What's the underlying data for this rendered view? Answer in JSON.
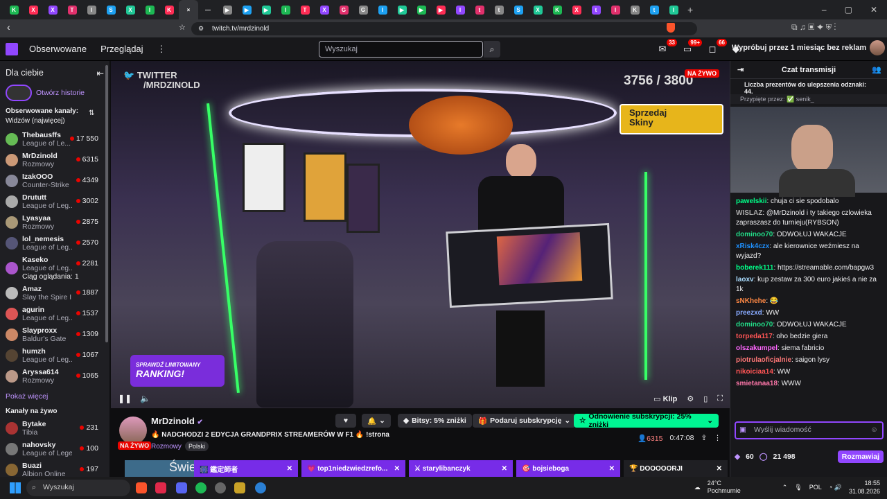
{
  "browser": {
    "url": "twitch.tv/mrdzinold",
    "tabs": [
      "K",
      "X",
      "X",
      "T",
      "I",
      "S",
      "X",
      "I",
      "K",
      "×",
      "—",
      "▶",
      "▶",
      "▶",
      "I",
      "T",
      "X",
      "G",
      "G",
      "I",
      "▶",
      "▶",
      "▶",
      "I",
      "t",
      "t",
      "S",
      "X",
      "K",
      "X",
      "t",
      "I",
      "K",
      "t",
      "I"
    ],
    "new_tab": "+",
    "ctl_min": "–",
    "ctl_max": "▢",
    "ctl_close": "✕"
  },
  "twitch": {
    "following": "Obserwowane",
    "browse": "Przeglądaj",
    "more": "⋮",
    "search_placeholder": "Wyszukaj",
    "badges": [
      "33",
      "99+",
      "66"
    ],
    "turbo": "Wypróbuj przez 1 miesiąc bez reklam"
  },
  "sidebar": {
    "title": "Dla ciebie",
    "stories": "Otwórz historie",
    "followed_label": "Obserwowane kanały:",
    "sort": "Widzów (najwięcej)",
    "channels": [
      {
        "name": "Thebausffs",
        "game": "League of Le...",
        "viewers": "17 550",
        "c": "#6b5"
      },
      {
        "name": "MrDzinold",
        "game": "Rozmowy",
        "viewers": "6315",
        "c": "#c97"
      },
      {
        "name": "IzakOOO",
        "game": "Counter-Strike",
        "viewers": "4349",
        "c": "#889"
      },
      {
        "name": "Drututt",
        "game": "League of Leg...",
        "viewers": "3002",
        "c": "#aaa"
      },
      {
        "name": "Lyasyaa",
        "game": "Rozmowy",
        "viewers": "2875",
        "c": "#a97"
      },
      {
        "name": "lol_nemesis",
        "game": "League of Leg...",
        "viewers": "2570",
        "c": "#557"
      },
      {
        "name": "Kaseko",
        "game": "League of Leg...",
        "viewers": "2281",
        "c": "#a5c"
      },
      {
        "name": "Amaz",
        "game": "Slay the Spire II",
        "viewers": "1887",
        "c": "#bbb"
      },
      {
        "name": "agurin",
        "game": "League of Leg...",
        "viewers": "1537",
        "c": "#d55"
      },
      {
        "name": "Slayproxx",
        "game": "Baldur's Gate",
        "viewers": "1309",
        "c": "#c86"
      },
      {
        "name": "humzh",
        "game": "League of Leg...",
        "viewers": "1067",
        "c": "#543"
      },
      {
        "name": "Aryssa614",
        "game": "Rozmowy",
        "viewers": "1065",
        "c": "#b98"
      }
    ],
    "kaseko_extra": "Ciąg oglądania: 1",
    "show_more": "Pokaż więcej",
    "live_label": "Kanały na żywo",
    "live": [
      {
        "name": "Bytake",
        "game": "Tibia",
        "viewers": "231",
        "c": "#a33"
      },
      {
        "name": "nahovsky",
        "game": "League of Lege...",
        "viewers": "100",
        "c": "#777"
      },
      {
        "name": "Buazi",
        "game": "Albion Online",
        "viewers": "197",
        "c": "#863"
      }
    ]
  },
  "player": {
    "twitter": "TWITTER",
    "handle": "/MRDZINOLD",
    "counter": "3756 / 3800",
    "live": "NA ŻYWO",
    "promo1": "Sprzedaj",
    "promo2": "Skiny",
    "rank1": "SPRAWDŹ LIMITOWANY",
    "rank2": "RANKING!",
    "clip": "Klip"
  },
  "stream": {
    "name": "MrDzinold",
    "live": "NA ŻYWO",
    "title": "🔥 NADCHODZI 2 EDYCJA GRANDPRIX STREAMERÓW W F1 🔥 !strona",
    "category": "Rozmowy",
    "tag": "Polski",
    "bits": "Bitsy: 5% zniżki",
    "gift": "Podaruj subskrypcję",
    "renew": "Odnowienie subskrypcji: 25% zniżki",
    "viewers": "6315",
    "uptime": "0:47:08"
  },
  "pins": [
    {
      "t": "🎆 鑑定師者"
    },
    {
      "t": "💗 top1niedzwiedzrefo..."
    },
    {
      "t": "⚔ starylibanczyk"
    },
    {
      "t": "🎯 bojsieboga"
    },
    {
      "t": "🏆 DOOOOORJI"
    }
  ],
  "chat": {
    "title": "Czat transmisji",
    "gifts": "Liczba prezentów do ulepszenia odznaki: 44.",
    "pinned": "Przypięte przez: ✅ senik_",
    "messages": [
      {
        "u": "pawelskii",
        "c": "#0f8",
        "t": ": chuja ci sie spodobalo"
      },
      {
        "u": "WISLAZ",
        "c": "#aaa",
        "t": ": @MrDzinold i ty takiego czlowieka zapraszasz do turnieju(RYBSON)"
      },
      {
        "u": "dominoo70",
        "c": "#2d8",
        "t": ": ODWOŁUJ WAKACJE"
      },
      {
        "u": "xRisk4czx",
        "c": "#1e90ff",
        "t": ": ale kierownice weźmiesz na wyjazd?"
      },
      {
        "u": "boberek111",
        "c": "#0f8",
        "t": ": https://streamable.com/bapgw3"
      },
      {
        "u": "laoxv",
        "c": "#adf",
        "t": ": kup zestaw za 300 euro jakieś a nie za 1k"
      },
      {
        "u": "sNKhehe",
        "c": "#f84",
        "t": ": 😂"
      },
      {
        "u": "preezxd",
        "c": "#8af",
        "t": ": WW"
      },
      {
        "u": "dominoo70",
        "c": "#2d8",
        "t": ": ODWOŁUJ WAKACJE"
      },
      {
        "u": "torpeda117",
        "c": "#f55",
        "t": ": oho bedzie giera"
      },
      {
        "u": "olszakumpel",
        "c": "#f6f",
        "t": ": siema fabricio"
      },
      {
        "u": "piotrulaoficjalnie",
        "c": "#f77",
        "t": ": saigon lysy"
      },
      {
        "u": "nikoiciaa14",
        "c": "#f55",
        "t": ": WW"
      },
      {
        "u": "smietanaa18",
        "c": "#f7a",
        "t": ": WWW"
      }
    ],
    "input": "Wyślij wiadomość",
    "points": "60",
    "pts2": "21 498",
    "send": "Rozmawiaj"
  },
  "taskbar": {
    "search": "Wyszukaj",
    "weather": "24°C",
    "weather2": "Pochmurnie",
    "lang": "POL",
    "time": "18:55",
    "date": "31.08.2026"
  }
}
